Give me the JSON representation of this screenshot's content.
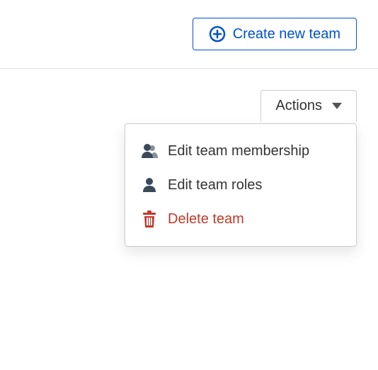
{
  "header": {
    "create_label": "Create new team"
  },
  "actions": {
    "button_label": "Actions",
    "items": [
      {
        "label": "Edit team membership"
      },
      {
        "label": "Edit team roles"
      },
      {
        "label": "Delete team"
      }
    ]
  }
}
